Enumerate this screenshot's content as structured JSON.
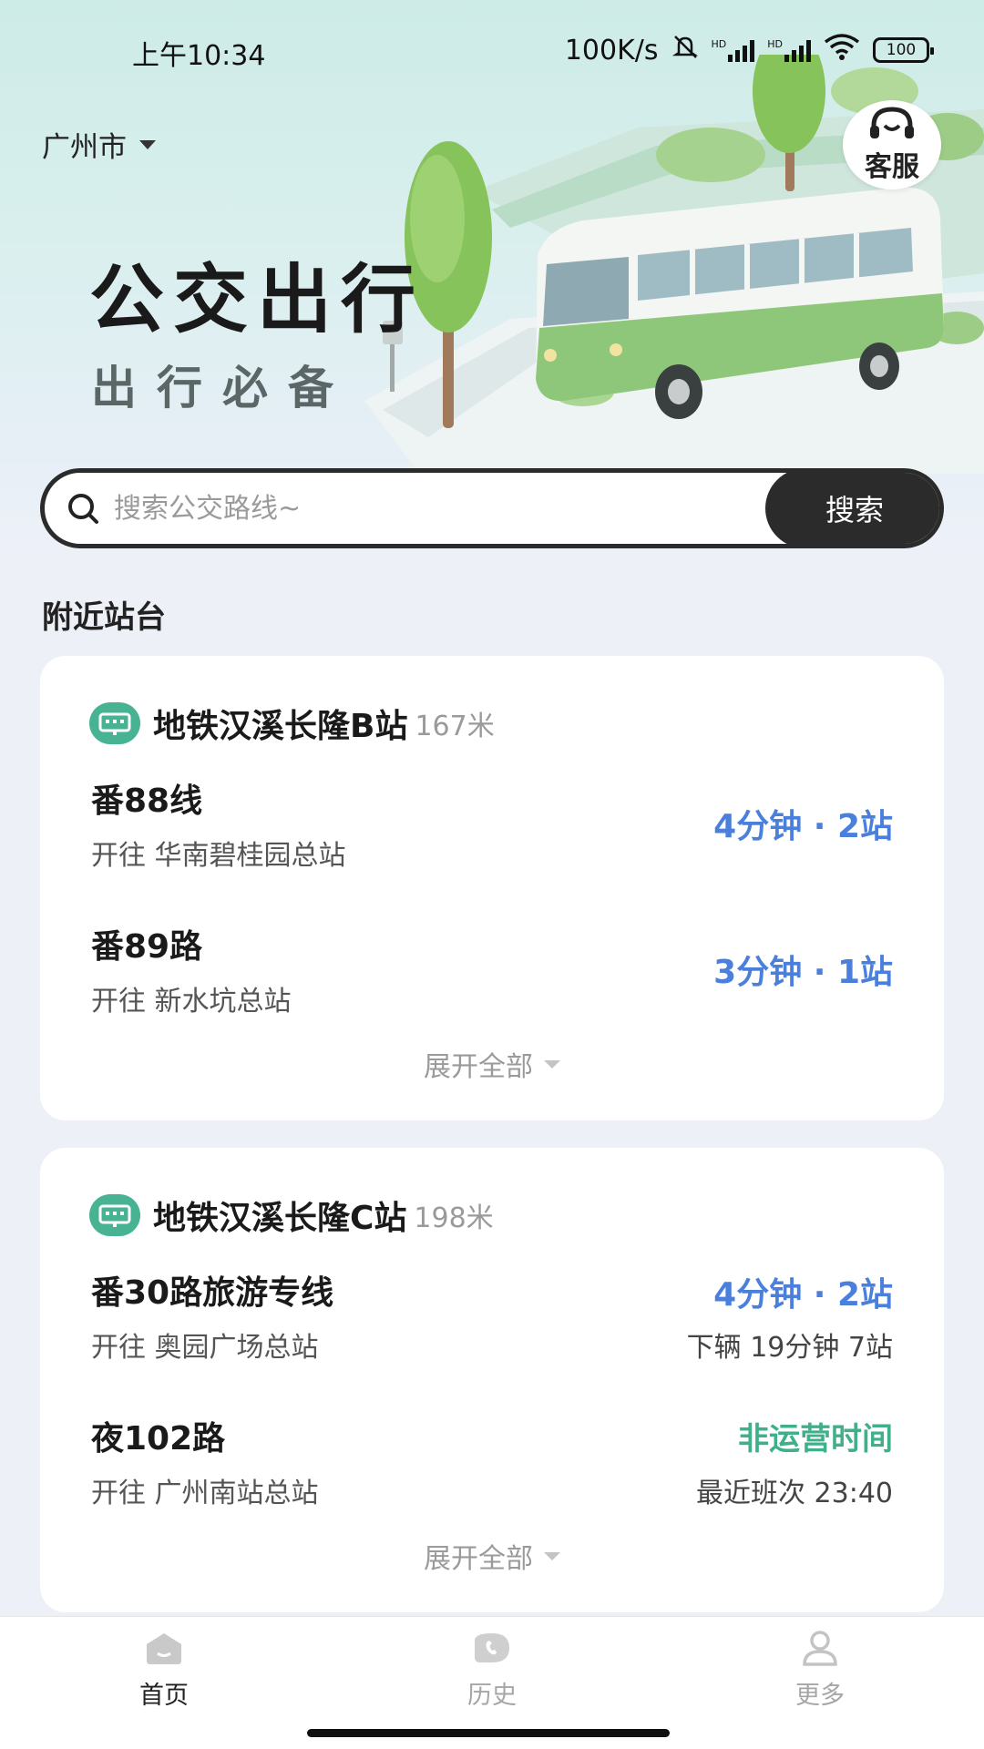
{
  "status_bar": {
    "time": "上午10:34",
    "speed": "100K/s",
    "battery": "100",
    "hd1": "HD",
    "hd2": "HD"
  },
  "header": {
    "city": "广州市",
    "service_label": "客服",
    "title": "公交出行",
    "subtitle": "出行必备"
  },
  "search": {
    "placeholder": "搜索公交路线~",
    "button_label": "搜索"
  },
  "nearby": {
    "section_title": "附近站台",
    "stations": [
      {
        "name": "地铁汉溪长隆B站",
        "distance": "167米",
        "routes": [
          {
            "name": "番88线",
            "direction": "开往 华南碧桂园总站",
            "eta": "4分钟 · 2站"
          },
          {
            "name": "番89路",
            "direction": "开往 新水坑总站",
            "eta": "3分钟 · 1站"
          }
        ],
        "expand_label": "展开全部"
      },
      {
        "name": "地铁汉溪长隆C站",
        "distance": "198米",
        "routes": [
          {
            "name": "番30路旅游专线",
            "direction": "开往 奥园广场总站",
            "eta": "4分钟 · 2站",
            "next": "下辆 19分钟 7站"
          },
          {
            "name": "夜102路",
            "direction": "开往 广州南站总站",
            "status": "非运营时间",
            "next": "最近班次 23:40"
          }
        ],
        "expand_label": "展开全部"
      }
    ]
  },
  "tabbar": {
    "tabs": [
      {
        "label": "首页",
        "icon": "home-icon",
        "active": true
      },
      {
        "label": "历史",
        "icon": "history-icon",
        "active": false
      },
      {
        "label": "更多",
        "icon": "user-icon",
        "active": false
      }
    ]
  },
  "colors": {
    "accent_blue": "#4a7fdc",
    "accent_green": "#3fb089",
    "stop_icon_bg": "#47b393",
    "search_dark": "#2b2b2b"
  }
}
